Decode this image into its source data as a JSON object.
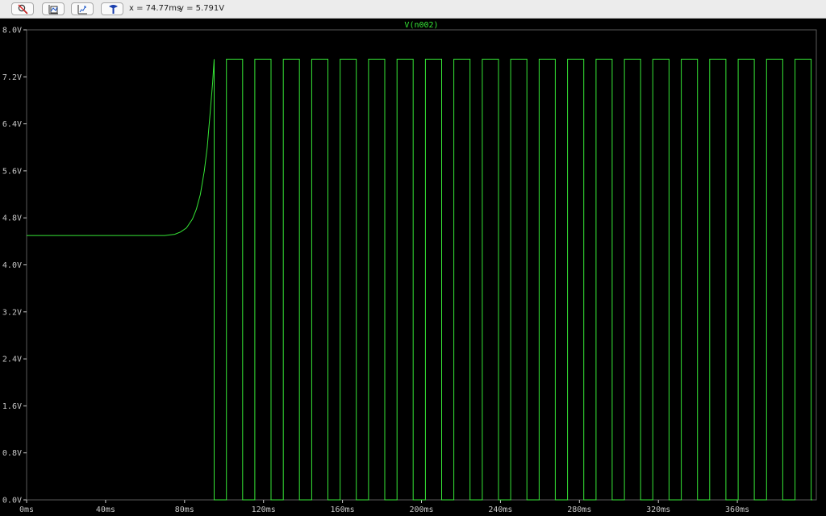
{
  "toolbar": {
    "buttons": [
      {
        "name": "zoom-cancel-button",
        "icon": "zoom-cancel-icon"
      },
      {
        "name": "autorange-button",
        "icon": "autorange-icon"
      },
      {
        "name": "pan-button",
        "icon": "pan-icon"
      },
      {
        "name": "probe-button",
        "icon": "probe-icon"
      }
    ],
    "cursor_x": "x = 74.77ms",
    "cursor_y": "y = 5.791V"
  },
  "colors": {
    "background": "#000000",
    "trace": "#36e636",
    "axis": "#c8c8c8",
    "grid": "#5a5a5a"
  },
  "chart_data": {
    "type": "line",
    "title": "V(n002)",
    "xlabel": "",
    "ylabel": "",
    "xlim": [
      0,
      400
    ],
    "ylim": [
      0,
      8
    ],
    "x_unit": "ms",
    "y_unit": "V",
    "x_ticks": [
      "0ms",
      "40ms",
      "80ms",
      "120ms",
      "160ms",
      "200ms",
      "240ms",
      "280ms",
      "320ms",
      "360ms"
    ],
    "y_ticks": [
      "0.0V",
      "0.8V",
      "1.6V",
      "2.4V",
      "3.2V",
      "4.0V",
      "4.8V",
      "5.6V",
      "6.4V",
      "7.2V",
      "8.0V"
    ],
    "grid": false,
    "series": [
      {
        "name": "V(n002)",
        "baseline": {
          "t_end_ms": 70,
          "v": 4.5
        },
        "ramp": [
          [
            70,
            4.5
          ],
          [
            75,
            4.52
          ],
          [
            78,
            4.56
          ],
          [
            81,
            4.63
          ],
          [
            84,
            4.78
          ],
          [
            86,
            4.95
          ],
          [
            88,
            5.2
          ],
          [
            90,
            5.6
          ],
          [
            91.5,
            6.0
          ],
          [
            93,
            6.6
          ],
          [
            94.2,
            7.1
          ],
          [
            95,
            7.5
          ]
        ],
        "square_wave": {
          "t_start_ms": 95,
          "t_end_ms": 398,
          "period_ms": 14.4,
          "high_ms": 8.2,
          "low_v": 0,
          "high_v": 7.5
        }
      }
    ]
  }
}
